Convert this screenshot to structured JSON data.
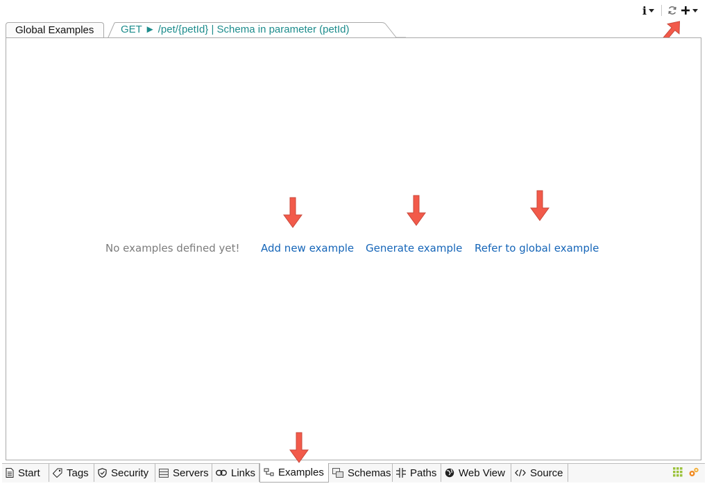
{
  "toolbar": {
    "info_icon": "info-icon",
    "refresh_icon": "refresh-icon",
    "add_icon": "plus-icon"
  },
  "editor_tabs": {
    "global_label": "Global Examples",
    "active_label": "GET ► /pet/{petId} | Schema in parameter (petId)"
  },
  "main": {
    "empty_message": "No examples defined yet!",
    "add_link": "Add new example",
    "generate_link": "Generate example",
    "refer_link": "Refer to global example"
  },
  "bottom_tabs": [
    {
      "label": "Start",
      "icon": "document-icon"
    },
    {
      "label": "Tags",
      "icon": "tag-icon"
    },
    {
      "label": "Security",
      "icon": "shield-icon"
    },
    {
      "label": "Servers",
      "icon": "server-icon"
    },
    {
      "label": "Links",
      "icon": "link-icon"
    },
    {
      "label": "Examples",
      "icon": "examples-icon"
    },
    {
      "label": "Schemas",
      "icon": "schemas-icon"
    },
    {
      "label": "Paths",
      "icon": "paths-icon"
    },
    {
      "label": "Web View",
      "icon": "globe-icon"
    },
    {
      "label": "Source",
      "icon": "code-icon"
    }
  ],
  "colors": {
    "link": "#1565b8",
    "tab_label": "#1d8c8c",
    "arrow": "#f25a4a",
    "muted": "#7c7c7c"
  }
}
